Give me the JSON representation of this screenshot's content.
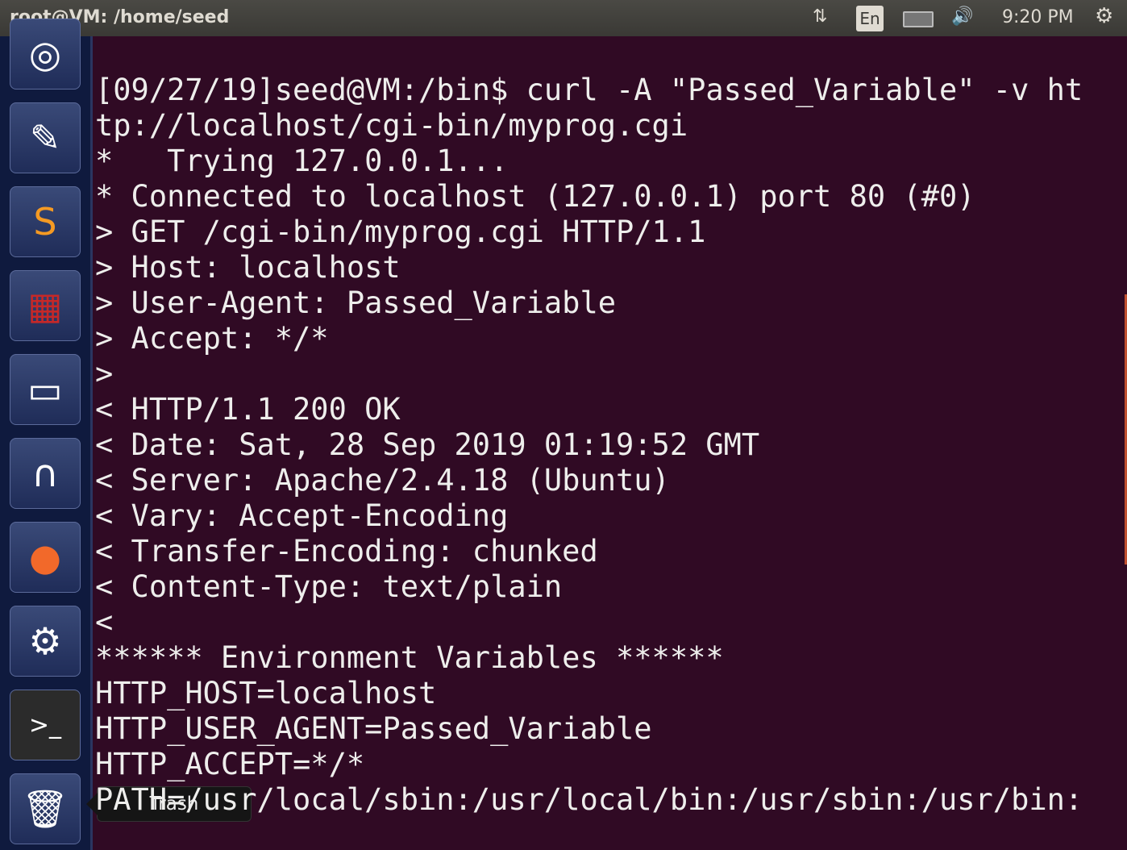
{
  "topbar": {
    "title": "root@VM: /home/seed",
    "keyboard": "En",
    "clock": "9:20 PM",
    "icons": [
      "network-updown-icon",
      "keyboard-layout-icon",
      "battery-icon",
      "volume-icon",
      "power-gear-icon"
    ]
  },
  "launcher": {
    "items": [
      {
        "name": "ubuntu-dash",
        "glyph": "◎"
      },
      {
        "name": "text-editor",
        "glyph": "✎"
      },
      {
        "name": "sublime-text",
        "glyph": "S"
      },
      {
        "name": "workspaces",
        "glyph": "▦"
      },
      {
        "name": "file-cabinet",
        "glyph": "▭"
      },
      {
        "name": "wireshark",
        "glyph": "∩"
      },
      {
        "name": "firefox",
        "glyph": "●"
      },
      {
        "name": "system-settings",
        "glyph": "⚙"
      },
      {
        "name": "terminal",
        "glyph": ">_"
      },
      {
        "name": "trash",
        "glyph": "🗑"
      }
    ],
    "tooltip": "Trash"
  },
  "terminal": {
    "bg": "#300a24",
    "lines": [
      "[09/27/19]seed@VM:/bin$ curl -A \"Passed_Variable\" -v ht",
      "tp://localhost/cgi-bin/myprog.cgi",
      "*   Trying 127.0.0.1...",
      "* Connected to localhost (127.0.0.1) port 80 (#0)",
      "> GET /cgi-bin/myprog.cgi HTTP/1.1",
      "> Host: localhost",
      "> User-Agent: Passed_Variable",
      "> Accept: */*",
      ">",
      "< HTTP/1.1 200 OK",
      "< Date: Sat, 28 Sep 2019 01:19:52 GMT",
      "< Server: Apache/2.4.18 (Ubuntu)",
      "< Vary: Accept-Encoding",
      "< Transfer-Encoding: chunked",
      "< Content-Type: text/plain",
      "<",
      "****** Environment Variables ******",
      "HTTP_HOST=localhost",
      "HTTP_USER_AGENT=Passed_Variable",
      "HTTP_ACCEPT=*/*",
      "PATH=/usr/local/sbin:/usr/local/bin:/usr/sbin:/usr/bin:"
    ]
  }
}
